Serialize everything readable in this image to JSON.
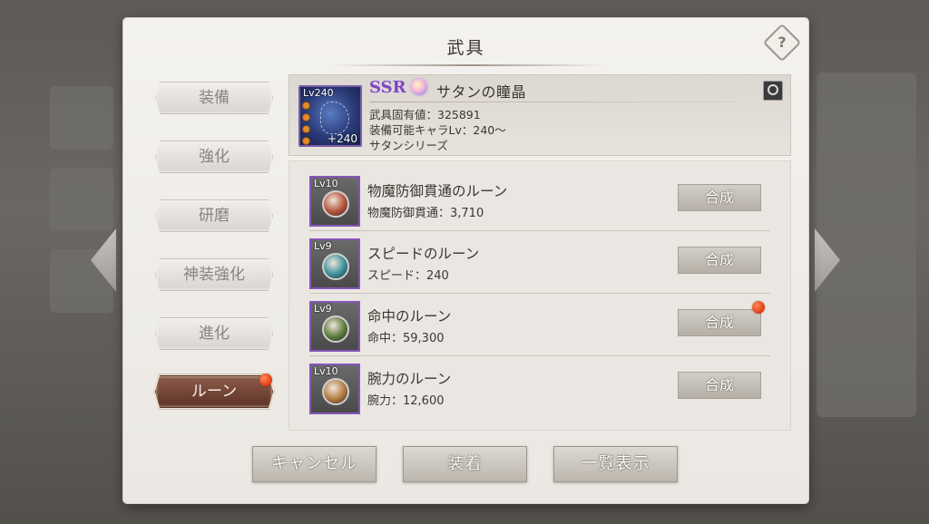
{
  "dialog": {
    "title": "武具",
    "help_icon_glyph": "?",
    "tabs": [
      {
        "label": "装備",
        "active": false
      },
      {
        "label": "強化",
        "active": false
      },
      {
        "label": "研磨",
        "active": false
      },
      {
        "label": "神装強化",
        "active": false
      },
      {
        "label": "進化",
        "active": false
      },
      {
        "label": "ルーン",
        "active": true,
        "has_notification": true
      }
    ]
  },
  "item": {
    "level": "Lv240",
    "plus": "+240",
    "rarity": "SSR",
    "name": "サタンの瞳晶",
    "stats": [
      "武具固有値：325891",
      "装備可能キャラLv：240〜",
      "サタンシリーズ"
    ],
    "lock_icon": "lock-icon"
  },
  "runes": [
    {
      "level": "Lv10",
      "name": "物魔防御貫通のルーン",
      "stat": "物魔防御貫通：3,710",
      "button": "合成",
      "orb_color": "#b5523a",
      "notify": false
    },
    {
      "level": "Lv9",
      "name": "スピードのルーン",
      "stat": "スピード：240",
      "button": "合成",
      "orb_color": "#3a8e9c",
      "notify": false
    },
    {
      "level": "Lv9",
      "name": "命中のルーン",
      "stat": "命中：59,300",
      "button": "合成",
      "orb_color": "#5b7a3a",
      "notify": true
    },
    {
      "level": "Lv10",
      "name": "腕力のルーン",
      "stat": "腕力：12,600",
      "button": "合成",
      "orb_color": "#b07a3e",
      "notify": false
    }
  ],
  "footer": {
    "cancel_label": "キャンセル",
    "equip_label": "装着",
    "list_label": "一覧表示"
  },
  "colors": {
    "rarity": "#7c46c8",
    "frame": "#8556b8",
    "notification": "#e03a10"
  }
}
